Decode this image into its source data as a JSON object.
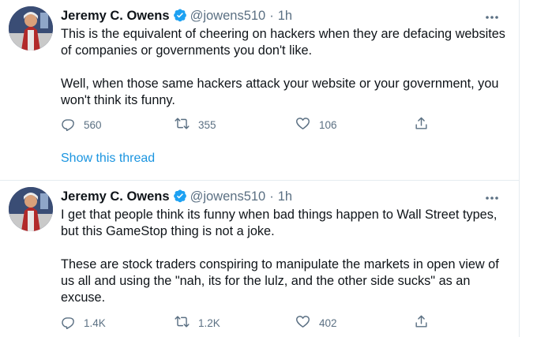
{
  "tweets": [
    {
      "author": {
        "name": "Jeremy C. Owens",
        "handle": "@jowens510",
        "separator": "·",
        "time": "1h"
      },
      "paragraphs": [
        "This is the equivalent of cheering on hackers when they are defacing websites of companies or governments you don't like.",
        "Well, when those same hackers attack your website or your government, you won't think its funny."
      ],
      "stats": {
        "replies": "560",
        "retweets": "355",
        "likes": "106"
      },
      "show_thread": "Show this thread"
    },
    {
      "author": {
        "name": "Jeremy C. Owens",
        "handle": "@jowens510",
        "separator": "·",
        "time": "1h"
      },
      "paragraphs": [
        "I get that people think its funny when bad things happen to Wall Street types, but this GameStop thing is not a joke.",
        "These are stock traders conspiring to manipulate the markets in open view of us all and using the \"nah, its for the lulz, and the other side sucks\" as an excuse."
      ],
      "stats": {
        "replies": "1.4K",
        "retweets": "1.2K",
        "likes": "402"
      }
    }
  ],
  "colors": {
    "verified_badge": "#1da1f2",
    "link": "#1b95e0",
    "muted": "#5b7083",
    "text": "#0f1419",
    "divider": "#e6ecf0"
  },
  "icons": [
    "more-icon",
    "verified-icon",
    "reply-icon",
    "retweet-icon",
    "like-icon",
    "share-icon"
  ]
}
